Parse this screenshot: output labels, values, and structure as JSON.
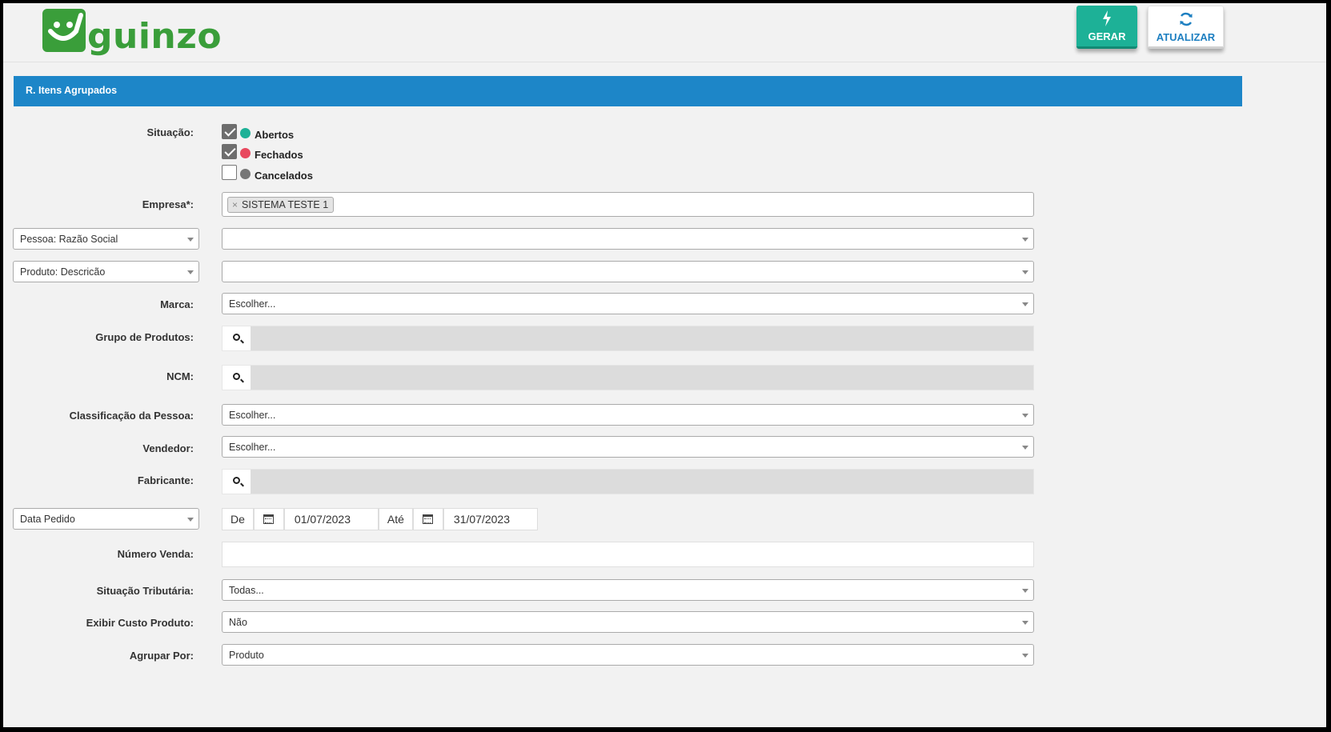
{
  "header": {
    "logo_text": "guinzo",
    "gerar_label": "GERAR",
    "atualizar_label": "ATUALIZAR"
  },
  "panel": {
    "title": "R. Itens Agrupados"
  },
  "situacao": {
    "label": "Situação:",
    "options": [
      {
        "label": "Abertos",
        "checked": true,
        "color": "#1db197"
      },
      {
        "label": "Fechados",
        "checked": true,
        "color": "#e8485e"
      },
      {
        "label": "Cancelados",
        "checked": false,
        "color": "#777777"
      }
    ]
  },
  "empresa": {
    "label": "Empresa*:",
    "tag": "SISTEMA TESTE 1",
    "remove": "×"
  },
  "pessoa": {
    "selector": "Pessoa: Razão Social",
    "value": ""
  },
  "produto": {
    "selector": "Produto: Descricão",
    "value": ""
  },
  "marca": {
    "label": "Marca:",
    "value": "Escolher..."
  },
  "grupo_produtos": {
    "label": "Grupo de Produtos:"
  },
  "ncm": {
    "label": "NCM:"
  },
  "classificacao": {
    "label": "Classificação da Pessoa:",
    "value": "Escolher..."
  },
  "vendedor": {
    "label": "Vendedor:",
    "value": "Escolher..."
  },
  "fabricante": {
    "label": "Fabricante:"
  },
  "data": {
    "selector": "Data Pedido",
    "de_label": "De",
    "de_value": "01/07/2023",
    "ate_label": "Até",
    "ate_value": "31/07/2023"
  },
  "numero_venda": {
    "label": "Número Venda:",
    "value": ""
  },
  "situacao_tributaria": {
    "label": "Situação Tributária:",
    "value": "Todas..."
  },
  "exibir_custo": {
    "label": "Exibir Custo Produto:",
    "value": "Não"
  },
  "agrupar_por": {
    "label": "Agrupar Por:",
    "value": "Produto"
  },
  "colors": {
    "accent": "#1d86c8",
    "gerar": "#1db197",
    "brand": "#3a9e3a"
  }
}
